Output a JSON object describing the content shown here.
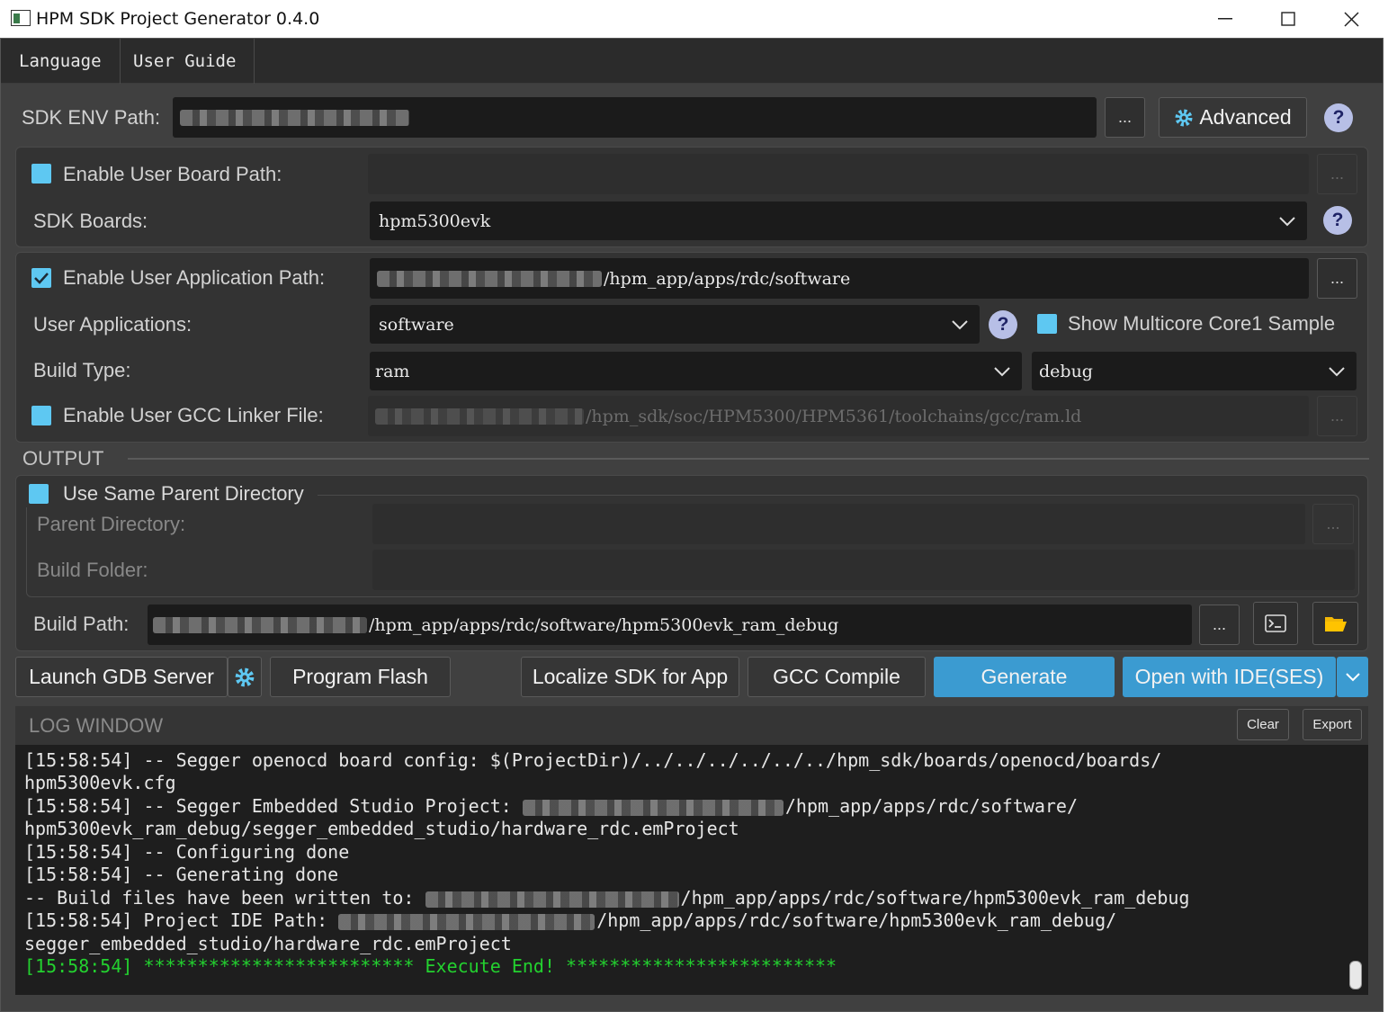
{
  "window": {
    "title": "HPM SDK Project Generator 0.4.0"
  },
  "menu": {
    "language": "Language",
    "user_guide": "User Guide"
  },
  "sdk_env": {
    "label": "SDK ENV Path:",
    "browse": "...",
    "advanced": "Advanced",
    "help": "?"
  },
  "board": {
    "enable_user_board_label": "Enable User Board Path:",
    "browse": "...",
    "sdk_boards_label": "SDK Boards:",
    "sdk_boards_value": "hpm5300evk",
    "help": "?"
  },
  "app": {
    "enable_user_app_label": "Enable User Application Path:",
    "app_path_suffix": "/hpm_app/apps/rdc/software",
    "browse": "...",
    "user_apps_label": "User Applications:",
    "user_apps_value": "software",
    "help": "?",
    "multicore_label": "Show Multicore Core1 Sample",
    "build_type_label": "Build Type:",
    "build_type_value": "ram",
    "build_mode_value": "debug",
    "linker_label": "Enable User GCC Linker File:",
    "linker_path_suffix": "/hpm_sdk/soc/HPM5300/HPM5361/toolchains/gcc/ram.ld",
    "linker_browse": "..."
  },
  "output": {
    "section_label": "OUTPUT",
    "same_parent_label": "Use Same Parent Directory",
    "parent_dir_label": "Parent Directory:",
    "parent_browse": "...",
    "build_folder_label": "Build Folder:",
    "build_path_label": "Build Path:",
    "build_path_suffix": "/hpm_app/apps/rdc/software/hpm5300evk_ram_debug",
    "build_browse": "..."
  },
  "actions": {
    "launch_gdb": "Launch GDB Server",
    "program_flash": "Program Flash",
    "localize_sdk": "Localize SDK for App",
    "gcc_compile": "GCC Compile",
    "generate": "Generate",
    "open_ide": "Open with IDE(SES)"
  },
  "log": {
    "title": "LOG WINDOW",
    "clear": "Clear",
    "export": "Export",
    "lines": {
      "l1": "[15:58:54] -- Segger openocd board config: $(ProjectDir)/../../../../../../hpm_sdk/boards/openocd/boards/",
      "l2": "hpm5300evk.cfg",
      "l3a": "[15:58:54] -- Segger Embedded Studio Project: ",
      "l3b": "/hpm_app/apps/rdc/software/",
      "l4": "hpm5300evk_ram_debug/segger_embedded_studio/hardware_rdc.emProject",
      "l5": "[15:58:54] -- Configuring done",
      "l6": "[15:58:54] -- Generating done",
      "l7a": "-- Build files have been written to: ",
      "l7b": "/hpm_app/apps/rdc/software/hpm5300evk_ram_debug",
      "l8a": "[15:58:54] Project IDE Path: ",
      "l8b": "/hpm_app/apps/rdc/software/hpm5300evk_ram_debug/",
      "l9": "segger_embedded_studio/hardware_rdc.emProject",
      "l10": "[15:58:54] ************************* Execute End! *************************"
    }
  },
  "colors": {
    "accent": "#3b9bd1",
    "checkbox": "#5ec8f2",
    "log_success": "#23d12f",
    "help_icon": "#b7bfe6"
  }
}
